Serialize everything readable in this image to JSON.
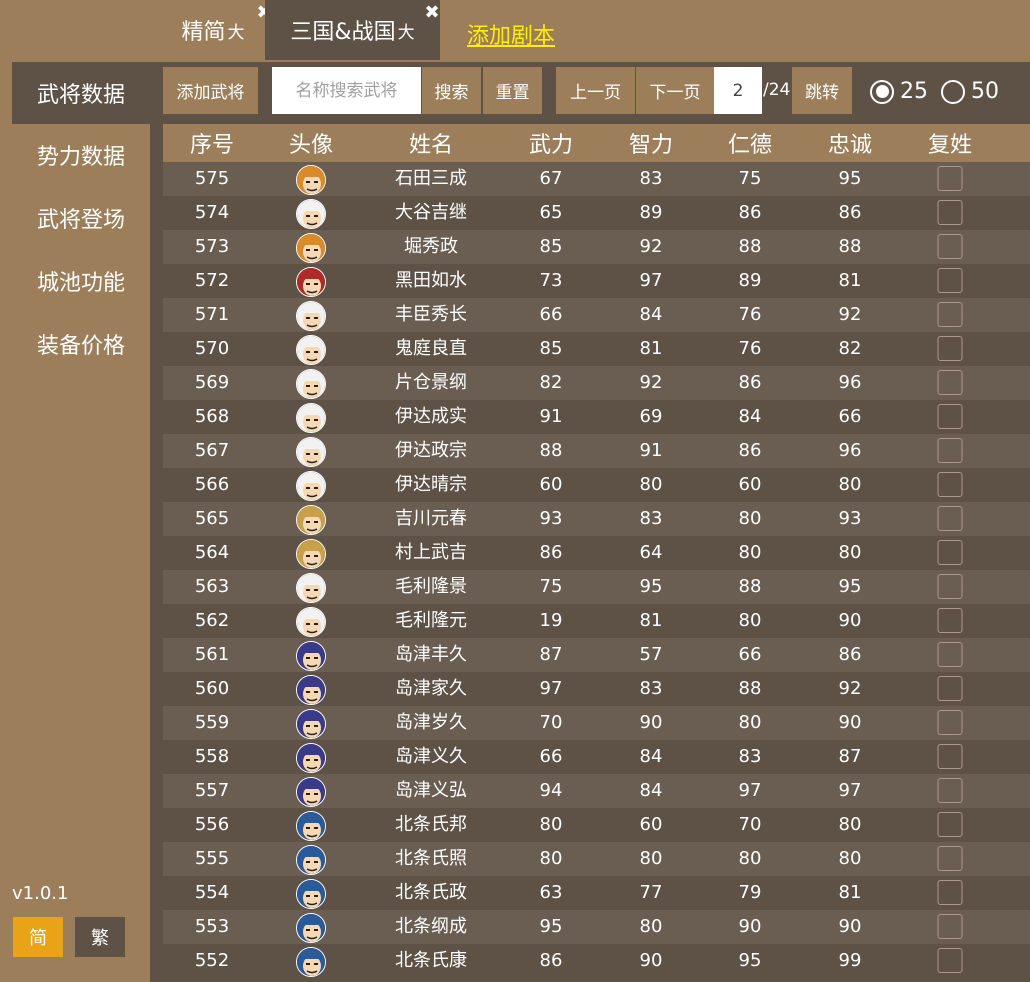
{
  "tabs": [
    {
      "label": "精简",
      "sub": "大"
    },
    {
      "label": "三国&战国",
      "sub": "大"
    }
  ],
  "add_script_label": "添加剧本",
  "sidebar": {
    "items": [
      {
        "label": "武将数据"
      },
      {
        "label": "势力数据"
      },
      {
        "label": "武将登场"
      },
      {
        "label": "城池功能"
      },
      {
        "label": "装备价格"
      }
    ]
  },
  "version": "v1.0.1",
  "lang": {
    "simplified": "简",
    "traditional": "繁"
  },
  "toolbar": {
    "add_general": "添加武将",
    "search_placeholder": "名称搜索武将",
    "search": "搜索",
    "reset": "重置",
    "prev": "上一页",
    "next": "下一页",
    "page_value": "2",
    "page_total": "/24",
    "jump": "跳转",
    "page_size_options": [
      "25",
      "50"
    ],
    "page_size_selected": "25"
  },
  "table": {
    "headers": [
      "序号",
      "头像",
      "姓名",
      "武力",
      "智力",
      "仁德",
      "忠诚",
      "复姓"
    ],
    "rows": [
      {
        "id": "575",
        "name": "石田三成",
        "str": "67",
        "int": "83",
        "vir": "75",
        "loy": "95",
        "avatar": "#d98a2a"
      },
      {
        "id": "574",
        "name": "大谷吉继",
        "str": "65",
        "int": "89",
        "vir": "86",
        "loy": "86",
        "avatar": "#f2f2f2"
      },
      {
        "id": "573",
        "name": "堀秀政",
        "str": "85",
        "int": "92",
        "vir": "88",
        "loy": "88",
        "avatar": "#d98a2a"
      },
      {
        "id": "572",
        "name": "黑田如水",
        "str": "73",
        "int": "97",
        "vir": "89",
        "loy": "81",
        "avatar": "#b02a2a"
      },
      {
        "id": "571",
        "name": "丰臣秀长",
        "str": "66",
        "int": "84",
        "vir": "76",
        "loy": "92",
        "avatar": "#f2f2f2"
      },
      {
        "id": "570",
        "name": "鬼庭良直",
        "str": "85",
        "int": "81",
        "vir": "76",
        "loy": "82",
        "avatar": "#f2f2f2"
      },
      {
        "id": "569",
        "name": "片仓景纲",
        "str": "82",
        "int": "92",
        "vir": "86",
        "loy": "96",
        "avatar": "#f2f2f2"
      },
      {
        "id": "568",
        "name": "伊达成实",
        "str": "91",
        "int": "69",
        "vir": "84",
        "loy": "66",
        "avatar": "#f2f2f2"
      },
      {
        "id": "567",
        "name": "伊达政宗",
        "str": "88",
        "int": "91",
        "vir": "86",
        "loy": "96",
        "avatar": "#f2f2f2"
      },
      {
        "id": "566",
        "name": "伊达晴宗",
        "str": "60",
        "int": "80",
        "vir": "60",
        "loy": "80",
        "avatar": "#f2f2f2"
      },
      {
        "id": "565",
        "name": "吉川元春",
        "str": "93",
        "int": "83",
        "vir": "80",
        "loy": "93",
        "avatar": "#c9a04a"
      },
      {
        "id": "564",
        "name": "村上武吉",
        "str": "86",
        "int": "64",
        "vir": "80",
        "loy": "80",
        "avatar": "#c9a04a"
      },
      {
        "id": "563",
        "name": "毛利隆景",
        "str": "75",
        "int": "95",
        "vir": "88",
        "loy": "95",
        "avatar": "#f2f2f2"
      },
      {
        "id": "562",
        "name": "毛利隆元",
        "str": "19",
        "int": "81",
        "vir": "80",
        "loy": "90",
        "avatar": "#f2f2f2"
      },
      {
        "id": "561",
        "name": "岛津丰久",
        "str": "87",
        "int": "57",
        "vir": "66",
        "loy": "86",
        "avatar": "#3a3a8a"
      },
      {
        "id": "560",
        "name": "岛津家久",
        "str": "97",
        "int": "83",
        "vir": "88",
        "loy": "92",
        "avatar": "#3a3a8a"
      },
      {
        "id": "559",
        "name": "岛津岁久",
        "str": "70",
        "int": "90",
        "vir": "80",
        "loy": "90",
        "avatar": "#3a3a8a"
      },
      {
        "id": "558",
        "name": "岛津义久",
        "str": "66",
        "int": "84",
        "vir": "83",
        "loy": "87",
        "avatar": "#3a3a8a"
      },
      {
        "id": "557",
        "name": "岛津义弘",
        "str": "94",
        "int": "84",
        "vir": "97",
        "loy": "97",
        "avatar": "#3a3a8a"
      },
      {
        "id": "556",
        "name": "北条氏邦",
        "str": "80",
        "int": "60",
        "vir": "70",
        "loy": "80",
        "avatar": "#2a5a9a"
      },
      {
        "id": "555",
        "name": "北条氏照",
        "str": "80",
        "int": "80",
        "vir": "80",
        "loy": "80",
        "avatar": "#2a5a9a"
      },
      {
        "id": "554",
        "name": "北条氏政",
        "str": "63",
        "int": "77",
        "vir": "79",
        "loy": "81",
        "avatar": "#2a5a9a"
      },
      {
        "id": "553",
        "name": "北条纲成",
        "str": "95",
        "int": "80",
        "vir": "90",
        "loy": "90",
        "avatar": "#2a5a9a"
      },
      {
        "id": "552",
        "name": "北条氏康",
        "str": "86",
        "int": "90",
        "vir": "95",
        "loy": "99",
        "avatar": "#2a5a9a"
      }
    ]
  },
  "colors": {
    "background": "#9c7f5a",
    "panel": "#5e5246",
    "row_alt": "#6a5e52",
    "accent": "#e8a317",
    "link": "#ffee00"
  }
}
